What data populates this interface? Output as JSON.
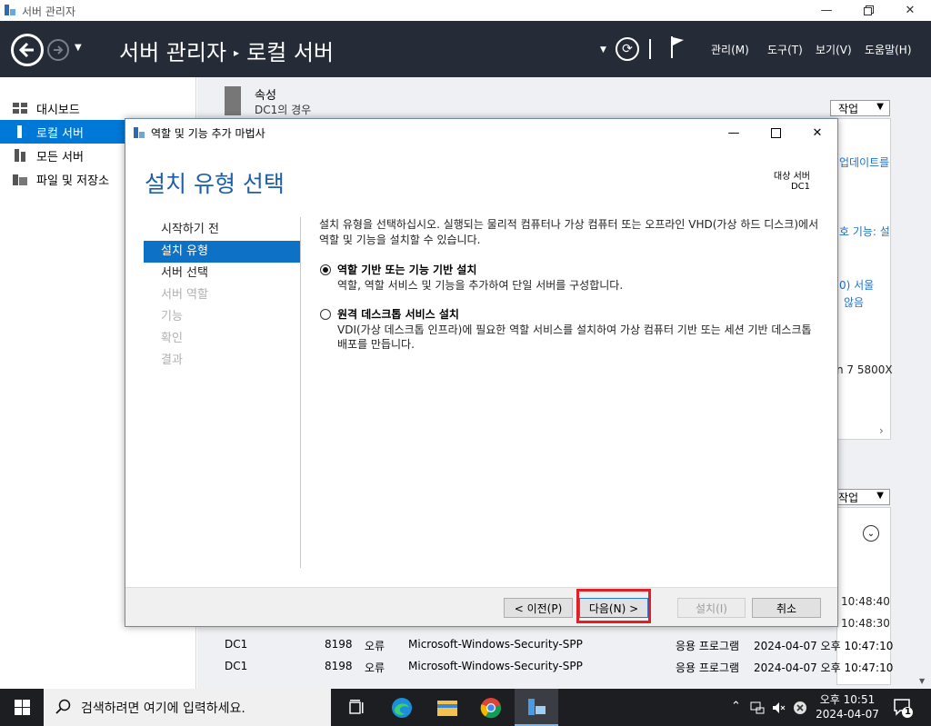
{
  "window": {
    "title": "서버 관리자",
    "minimize_icon": "minimize-icon",
    "restore_icon": "restore-icon",
    "close_icon": "close-icon"
  },
  "header": {
    "breadcrumb_root": "서버 관리자",
    "breadcrumb_separator": "▸",
    "breadcrumb_current": "로컬 서버",
    "menus": [
      "관리(M)",
      "도구(T)",
      "보기(V)",
      "도움말(H)"
    ]
  },
  "sidebar": {
    "items": [
      {
        "label": "대시보드",
        "icon": "dashboard-icon"
      },
      {
        "label": "로컬 서버",
        "icon": "local-server-icon",
        "selected": true
      },
      {
        "label": "모든 서버",
        "icon": "all-servers-icon"
      },
      {
        "label": "파일 및 저장소",
        "icon": "file-storage-icon"
      }
    ]
  },
  "background": {
    "properties_title": "속성",
    "properties_subtitle": "DC1의 경우",
    "tasks_label": "작업",
    "partial_texts": [
      "업데이트를",
      "호 기능: 설",
      "0) 서울",
      "않음",
      "n 7 5800X"
    ],
    "events_tasks_label": "작업",
    "event_times": [
      "10:48:40",
      "10:48:30"
    ],
    "event_rows": [
      {
        "server": "DC1",
        "id": "8198",
        "level": "오류",
        "source": "Microsoft-Windows-Security-SPP",
        "log": "응용 프로그램",
        "datetime": "2024-04-07 오후 10:47:10"
      },
      {
        "server": "DC1",
        "id": "8198",
        "level": "오류",
        "source": "Microsoft-Windows-Security-SPP",
        "log": "응용 프로그램",
        "datetime": "2024-04-07 오후 10:47:10"
      }
    ]
  },
  "dialog": {
    "title": "역할 및 기능 추가 마법사",
    "heading": "설치 유형 선택",
    "target_label": "대상 서버",
    "target_value": "DC1",
    "steps": [
      {
        "label": "시작하기 전",
        "state": "normal"
      },
      {
        "label": "설치 유형",
        "state": "selected"
      },
      {
        "label": "서버 선택",
        "state": "normal"
      },
      {
        "label": "서버 역할",
        "state": "disabled"
      },
      {
        "label": "기능",
        "state": "disabled"
      },
      {
        "label": "확인",
        "state": "disabled"
      },
      {
        "label": "결과",
        "state": "disabled"
      }
    ],
    "description": "설치 유형을 선택하십시오. 실행되는 물리적 컴퓨터나 가상 컴퓨터 또는 오프라인 VHD(가상 하드 디스크)에서 역할 및 기능을 설치할 수 있습니다.",
    "options": [
      {
        "title": "역할 기반 또는 기능 기반 설치",
        "description": "역할, 역할 서비스 및 기능을 추가하여 단일 서버를 구성합니다.",
        "selected": true
      },
      {
        "title": "원격 데스크톱 서비스 설치",
        "description": "VDI(가상 데스크톱 인프라)에 필요한 역할 서비스를 설치하여 가상 컴퓨터 기반 또는 세션 기반 데스크톱 배포를 만듭니다.",
        "selected": false
      }
    ],
    "buttons": {
      "previous": "< 이전(P)",
      "next": "다음(N) >",
      "install": "설치(I)",
      "cancel": "취소"
    }
  },
  "taskbar": {
    "search_placeholder": "검색하려면 여기에 입력하세요.",
    "time": "오후 10:51",
    "date": "2024-04-07",
    "notification_count": "1"
  },
  "colors": {
    "header_bg": "#262c37",
    "accent": "#0078d7",
    "heading_blue": "#1e5fa8",
    "highlight_red": "#e01f26"
  }
}
